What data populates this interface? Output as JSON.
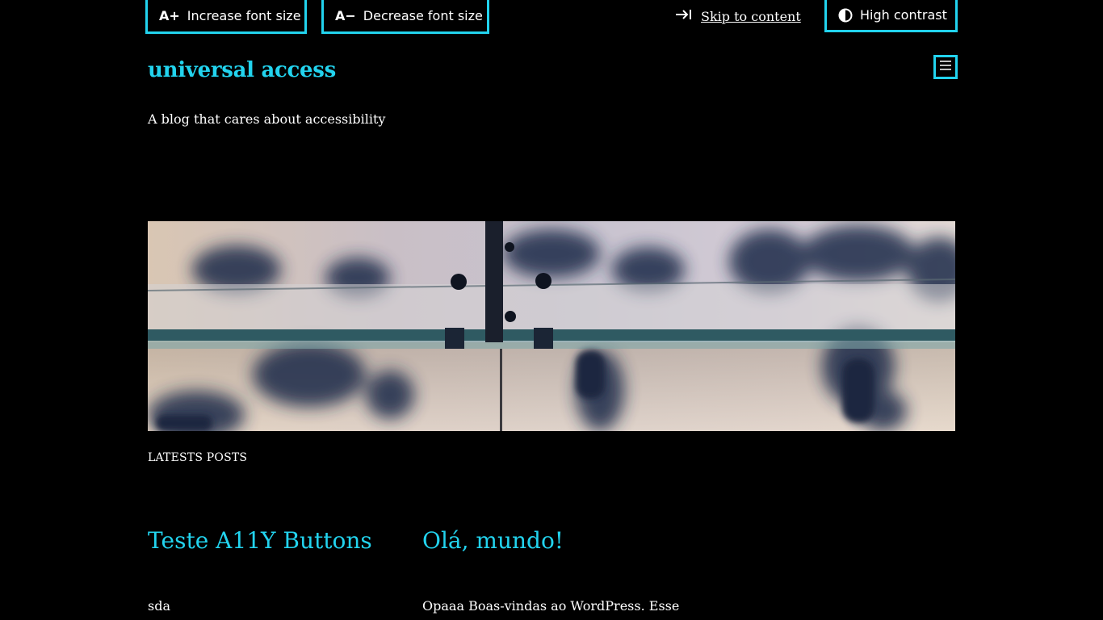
{
  "toolbar": {
    "increase_label": "Increase font size",
    "increase_icon_text": "A+",
    "decrease_label": "Decrease font size",
    "decrease_icon_text": "A−",
    "skip_label": "Skip to content",
    "contrast_label": "High contrast"
  },
  "header": {
    "site_title": "universal access",
    "tagline": "A blog that cares about accessibility"
  },
  "main": {
    "section_label": "LATESTS POSTS",
    "posts": [
      {
        "title": "Teste A11Y Buttons",
        "excerpt": "sda"
      },
      {
        "title": "Olá, mundo!",
        "excerpt": "Opaaa Boas-vindas ao WordPress. Esse"
      }
    ]
  },
  "colors": {
    "accent": "#22d3ee",
    "background": "#000000",
    "text": "#ffffff"
  },
  "icons": {
    "skip": "arrow-right-to-bar-icon",
    "contrast": "half-circle-contrast-icon",
    "menu": "hamburger-menu-icon"
  }
}
